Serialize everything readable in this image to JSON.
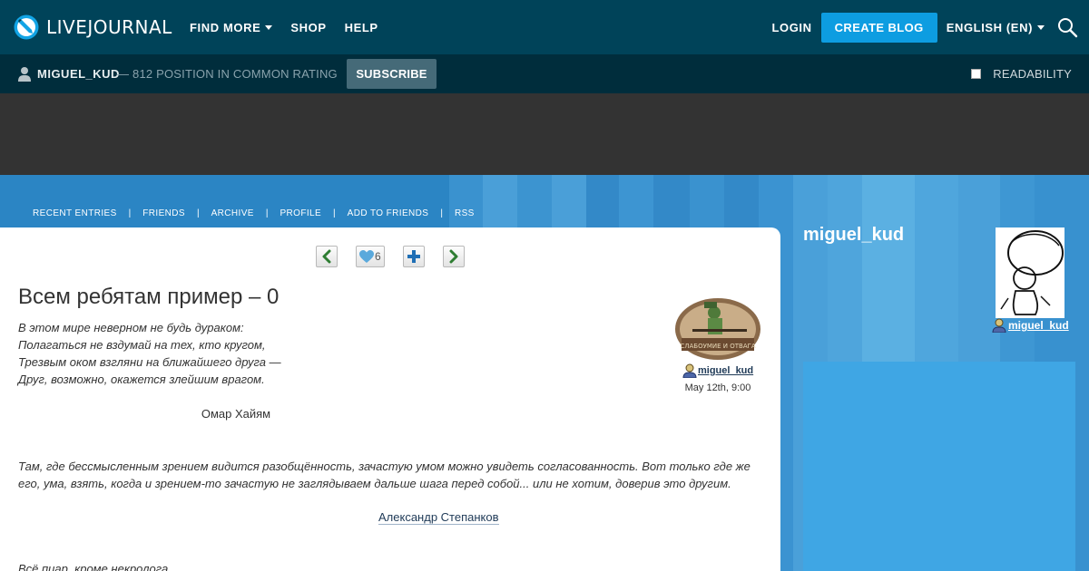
{
  "brand": {
    "name": "LIVEJOURNAL"
  },
  "topnav": {
    "find_more": "FIND MORE",
    "shop": "SHOP",
    "help": "HELP",
    "login": "LOGIN",
    "create_blog": "CREATE BLOG",
    "language": "ENGLISH (EN)"
  },
  "userbar": {
    "username": "MIGUEL_KUD",
    "rating": "— 812 POSITION IN COMMON RATING",
    "subscribe": "SUBSCRIBE",
    "readability": "READABILITY"
  },
  "journal_nav": [
    "RECENT ENTRIES",
    "FRIENDS",
    "ARCHIVE",
    "PROFILE",
    "ADD TO FRIENDS",
    "RSS"
  ],
  "entry": {
    "likes": "6",
    "title": "Всем ребятам пример – 0",
    "poem": [
      "В этом мире неверном не будь дураком:",
      "Полагаться не вздумай на тех, кто кругом,",
      "Трезвым оком взгляни на ближайшего друга —",
      "Друг, возможно, окажется злейшим врагом."
    ],
    "poem_author": "Омар Хайям",
    "quote": "Там, где бессмысленным зрением видится разобщённость, зачастую умом можно увидеть согласованность. Вот только где же его, ума, взять, когда и зрением-то зачастую не заглядываем дальше шага перед собой... или не хотим, доверив это другим.",
    "quote_author": "Александр Степанков",
    "last_line": "Всё пиар, кроме некролога.",
    "poster": "miguel_kud",
    "date": "May 12th, 9:00"
  },
  "sidebar": {
    "journal_name": "miguel_kud",
    "user": "miguel_kud"
  },
  "colors": {
    "topbar": "#004359",
    "userbar": "#002d3c",
    "accent": "#0d9de1",
    "header_blue": "#2b85c4",
    "sidebar_box": "#3fa6e4"
  }
}
